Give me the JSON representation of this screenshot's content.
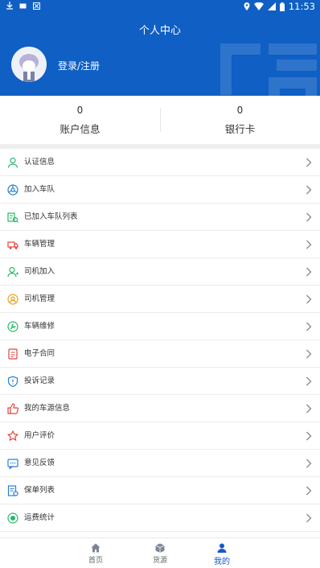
{
  "status_bar": {
    "time": "11:53"
  },
  "header": {
    "title": "个人中心",
    "login_text": "登录/注册"
  },
  "stats": [
    {
      "value": "0",
      "label": "账户信息"
    },
    {
      "value": "0",
      "label": "银行卡"
    }
  ],
  "menu": [
    {
      "label": "认证信息",
      "icon": "user-verify-icon",
      "color": "#29b86b"
    },
    {
      "label": "加入车队",
      "icon": "join-fleet-icon",
      "color": "#2a7fd4"
    },
    {
      "label": "已加入车队列表",
      "icon": "fleet-list-icon",
      "color": "#29b86b"
    },
    {
      "label": "车辆管理",
      "icon": "truck-icon",
      "color": "#e0453c"
    },
    {
      "label": "司机加入",
      "icon": "driver-add-icon",
      "color": "#29b86b"
    },
    {
      "label": "司机管理",
      "icon": "driver-manage-icon",
      "color": "#f0a020"
    },
    {
      "label": "车辆维修",
      "icon": "wrench-icon",
      "color": "#29b86b"
    },
    {
      "label": "电子合同",
      "icon": "contract-icon",
      "color": "#e0453c"
    },
    {
      "label": "投诉记录",
      "icon": "shield-icon",
      "color": "#2a7fd4"
    },
    {
      "label": "我的车源信息",
      "icon": "thumbs-up-icon",
      "color": "#e0453c"
    },
    {
      "label": "用户评价",
      "icon": "rating-icon",
      "color": "#e0453c"
    },
    {
      "label": "意见反馈",
      "icon": "feedback-icon",
      "color": "#2a7fd4"
    },
    {
      "label": "保单列表",
      "icon": "policy-icon",
      "color": "#2a7fd4"
    },
    {
      "label": "运费统计",
      "icon": "freight-stats-icon",
      "color": "#29b86b"
    }
  ],
  "tabs": [
    {
      "label": "首页",
      "icon": "home-icon",
      "active": false
    },
    {
      "label": "货源",
      "icon": "cargo-icon",
      "active": false
    },
    {
      "label": "我的",
      "icon": "profile-icon",
      "active": true
    }
  ],
  "colors": {
    "primary": "#0f5fc4",
    "active_tab": "#1a57c9"
  }
}
